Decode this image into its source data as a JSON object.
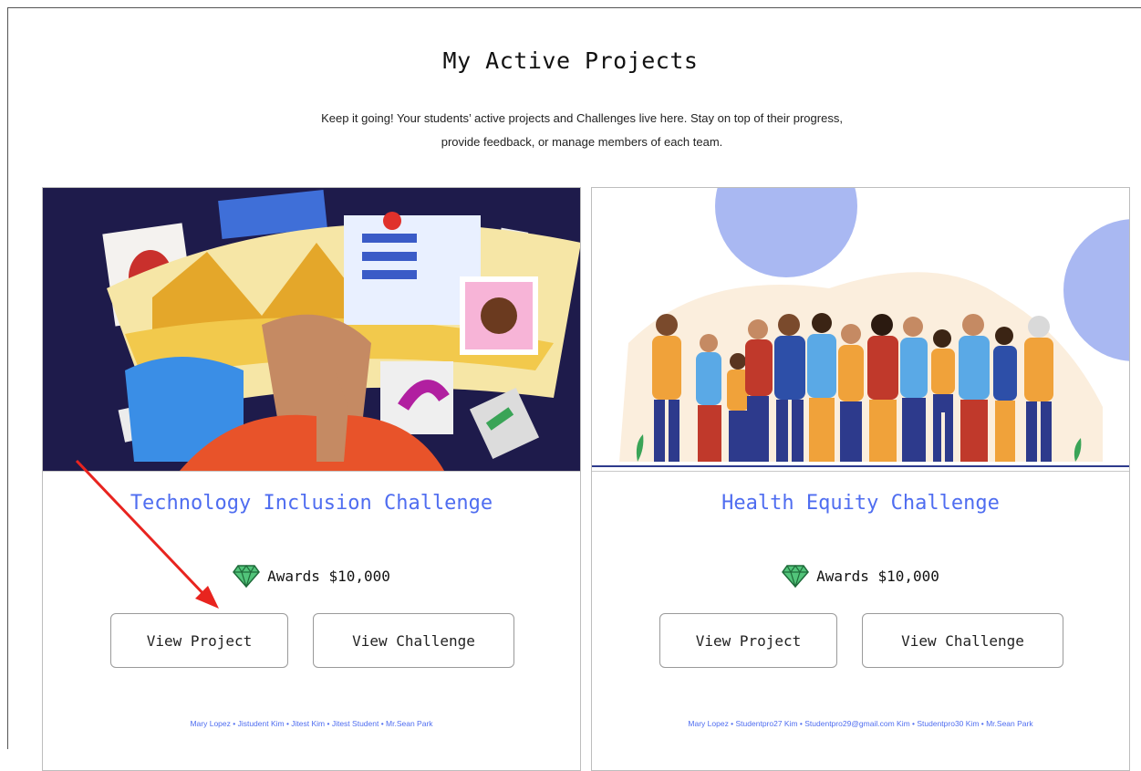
{
  "page": {
    "title": "My Active Projects",
    "subtitle_line1": "Keep it going! Your students’ active projects and Challenges live here. Stay on top of their progress,",
    "subtitle_line2": "provide feedback, or manage members of each team."
  },
  "cards": [
    {
      "title": "Technology Inclusion Challenge",
      "award": "Awards $10,000",
      "award_icon": "diamond-icon",
      "view_project_label": "View Project",
      "view_challenge_label": "View Challenge",
      "members": "Mary Lopez • Jistudent Kim • Jitest Kim • Jitest Student • Mr.Sean Park"
    },
    {
      "title": "Health Equity Challenge",
      "award": "Awards $10,000",
      "award_icon": "diamond-icon",
      "view_project_label": "View Project",
      "view_challenge_label": "View Challenge",
      "members": "Mary Lopez • Studentpro27 Kim • Studentpro29@gmail.com Kim • Studentpro30 Kim • Mr.Sean Park"
    }
  ],
  "colors": {
    "accent": "#4f6df0",
    "annotation_arrow": "#e8241f"
  }
}
